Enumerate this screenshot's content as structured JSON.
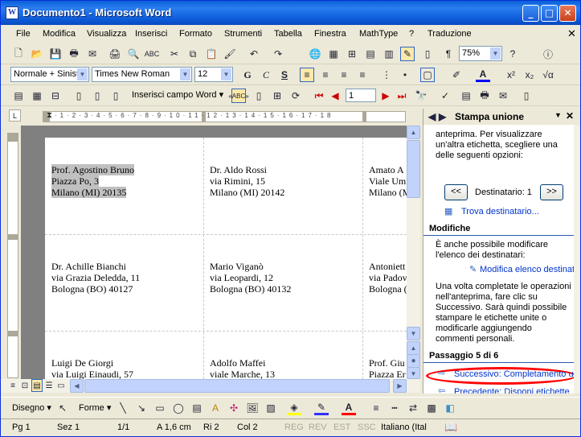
{
  "window": {
    "title": "Documento1 - Microsoft Word"
  },
  "menu": [
    "File",
    "Modifica",
    "Visualizza",
    "Inserisci",
    "Formato",
    "Strumenti",
    "Tabella",
    "Finestra",
    "MathType",
    "?",
    "Traduzione"
  ],
  "toolbar": {
    "zoom": "75%",
    "style": "Normale + Sinistr",
    "font": "Times New Roman",
    "size": "12",
    "insert_field": "Inserisci campo Word",
    "record": "1"
  },
  "labels": [
    {
      "lines": [
        "Prof. Agostino Bruno",
        "Piazza Po, 3",
        "Milano (MI) 20135"
      ]
    },
    {
      "lines": [
        "Dr. Aldo Rossi",
        "via Rimini, 15",
        "Milano (MI) 20142"
      ]
    },
    {
      "lines": [
        "Amato A",
        "Viale Um",
        "Milano (M"
      ]
    },
    {
      "lines": [
        "Dr. Achille Bianchi",
        "via Grazia Deledda, 11",
        "Bologna (BO) 40127"
      ]
    },
    {
      "lines": [
        "Mario Viganò",
        "via Leopardi, 12",
        "Bologna (BO) 40132"
      ]
    },
    {
      "lines": [
        "Antoniett",
        "via Padov",
        "Bologna (B"
      ]
    },
    {
      "lines": [
        "Luigi De Giorgi",
        "via Luigi Einaudi, 57"
      ]
    },
    {
      "lines": [
        "Adolfo Maffei",
        "viale Marche, 13"
      ]
    },
    {
      "lines": [
        "Prof. Giu",
        "Piazza Er"
      ]
    }
  ],
  "taskpane": {
    "title": "Stampa unione",
    "intro": "anteprima. Per visualizzare un'altra etichetta, scegliere una delle seguenti opzioni:",
    "prev_btn": "<<",
    "next_btn": ">>",
    "recipient": "Destinatario: 1",
    "find_link": "Trova destinatario...",
    "section_modifiche": "Modifiche",
    "modify_text": "È anche possibile modificare l'elenco dei destinatari:",
    "modify_link": "Modifica elenco destinatari...",
    "complete_text": "Una volta completate le operazioni nell'anteprima, fare clic su Successivo. Sarà quindi possibile stampare le etichette unite o modificarle aggiungendo commenti personali.",
    "step": "Passaggio 5 di 6",
    "next_step": "Successivo: Completamento unione",
    "prev_step": "Precedente: Disponi etichette"
  },
  "drawbar": {
    "disegno": "Disegno",
    "forme": "Forme"
  },
  "status": {
    "pg": "Pg 1",
    "sez": "Sez 1",
    "pages": "1/1",
    "at": "A 1,6 cm",
    "ri": "Ri 2",
    "col": "Col 2",
    "reg": "REG",
    "rev": "REV",
    "est": "EST",
    "ssc": "SSC",
    "lang": "Italiano (Ital"
  },
  "colors": {
    "titlebar": "#0a5fd8",
    "highlight_ellipse": "#ff0000",
    "link": "#0033cc"
  }
}
